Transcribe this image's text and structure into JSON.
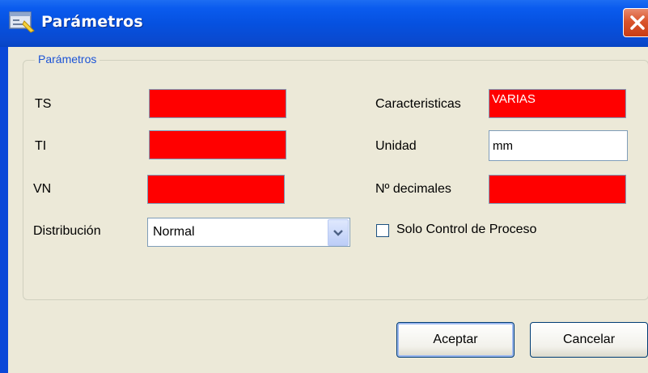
{
  "window": {
    "title": "Parámetros"
  },
  "group": {
    "legend": "Parámetros"
  },
  "fields": {
    "ts": {
      "label": "TS",
      "value": ""
    },
    "ti": {
      "label": "TI",
      "value": ""
    },
    "vn": {
      "label": "VN",
      "value": ""
    },
    "distribucion": {
      "label": "Distribución",
      "value": "Normal"
    },
    "caracteristicas": {
      "label": "Caracteristicas",
      "value": "VARIAS"
    },
    "unidad": {
      "label": "Unidad",
      "value": "mm"
    },
    "decimales": {
      "label": "Nº decimales",
      "value": ""
    }
  },
  "checkbox": {
    "label": "Solo Control de Proceso",
    "checked": false
  },
  "buttons": {
    "ok": "Aceptar",
    "cancel": "Cancelar"
  },
  "colors": {
    "required_field": "#ff0000",
    "titlebar": "#0a5bee",
    "dialog_bg": "#ece9d8"
  },
  "icons": {
    "title": "settings-form-icon",
    "close": "close-icon",
    "dropdown": "chevron-down-icon"
  }
}
